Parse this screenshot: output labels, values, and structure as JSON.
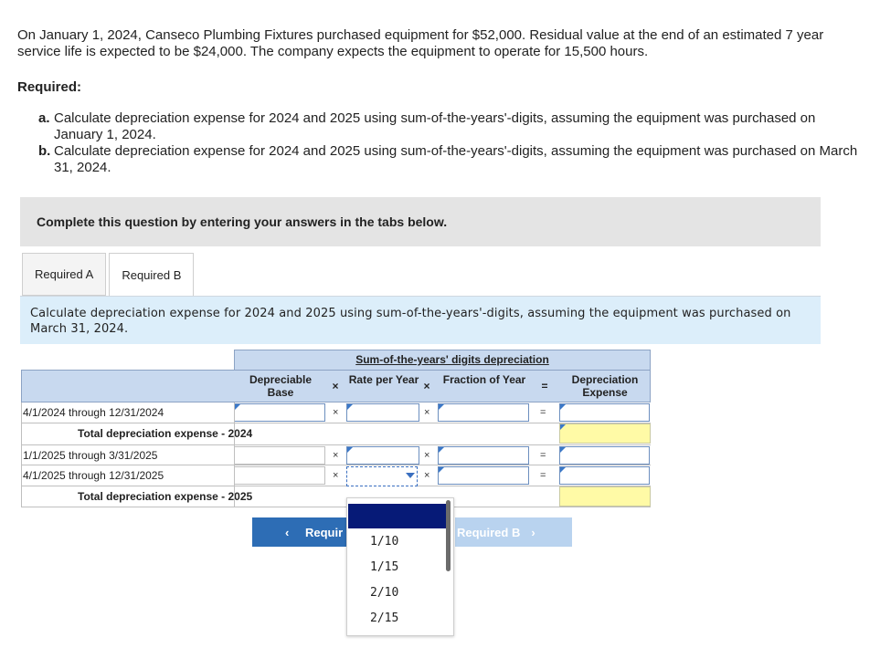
{
  "intro": "On January 1, 2024, Canseco Plumbing Fixtures purchased equipment for $52,000. Residual value at the end of an estimated 7 year service life is expected to be $24,000. The company expects the equipment to operate for 15,500 hours.",
  "required_heading": "Required:",
  "requirements": [
    {
      "letter": "a.",
      "text": "Calculate depreciation expense for 2024 and 2025 using sum-of-the-years'-digits, assuming the equipment was purchased on January 1, 2024."
    },
    {
      "letter": "b.",
      "text": "Calculate depreciation expense for 2024 and 2025 using sum-of-the-years'-digits, assuming the equipment was purchased on March 31, 2024."
    }
  ],
  "instruction": "Complete this question by entering your answers in the tabs below.",
  "tabs": [
    {
      "label": "Required A",
      "active": false
    },
    {
      "label": "Required B",
      "active": true
    }
  ],
  "prompt": "Calculate depreciation expense for 2024 and 2025 using sum-of-the-years'-digits, assuming the equipment was purchased on March 31, 2024.",
  "table": {
    "title": "Sum-of-the-years' digits depreciation",
    "headers": {
      "depreciable_base": "Depreciable Base",
      "op1": "×",
      "rate": "Rate per Year",
      "op2": "×",
      "fraction": "Fraction of Year",
      "eq": "=",
      "expense": "Depreciation Expense"
    },
    "rows": [
      {
        "label": "4/1/2024 through 12/31/2024"
      },
      {
        "label": "Total depreciation expense - 2024"
      },
      {
        "label": "1/1/2025 through 3/31/2025"
      },
      {
        "label": "4/1/2025 through 12/31/2025"
      },
      {
        "label": "Total depreciation expense - 2025"
      }
    ],
    "op_x": "×",
    "op_eq": "="
  },
  "nav": {
    "prev_label": "Requir",
    "next_label": "Required B"
  },
  "dropdown": {
    "options": [
      "1/10",
      "1/15",
      "2/10",
      "2/15"
    ]
  },
  "colors": {
    "header_blue": "#c8d9ef",
    "yellow_total": "#fffaa6",
    "nav_blue": "#2d6db5",
    "selected_option": "#061a77"
  }
}
